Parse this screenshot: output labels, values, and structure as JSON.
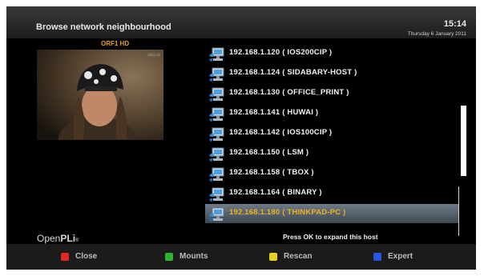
{
  "header": {
    "title": "Browse network neighbourhood",
    "time": "15:14",
    "date": "Thursday 6 January 2011"
  },
  "preview": {
    "channel": "ORF1 HD"
  },
  "hosts": [
    {
      "label": "192.168.1.120 ( IOS200CIP )",
      "selected": false
    },
    {
      "label": "192.168.1.124 ( SIDABARY-HOST )",
      "selected": false
    },
    {
      "label": "192.168.1.130 ( OFFICE_PRINT )",
      "selected": false
    },
    {
      "label": "192.168.1.141 ( HUWAI )",
      "selected": false
    },
    {
      "label": "192.168.1.142 ( IOS100CIP )",
      "selected": false
    },
    {
      "label": "192.168.1.150 ( LSM )",
      "selected": false
    },
    {
      "label": "192.168.1.158 ( TBOX )",
      "selected": false
    },
    {
      "label": "192.168.1.164 ( BINARY )",
      "selected": false
    },
    {
      "label": "192.168.1.180 ( THINKPAD-PC )",
      "selected": true
    }
  ],
  "logo": {
    "part1": "Open",
    "part2": "PLi",
    "suffix": "®"
  },
  "hint": "Press OK to expand this host",
  "footer": [
    {
      "label": "Close",
      "color": "#e02828"
    },
    {
      "label": "Mounts",
      "color": "#30b030"
    },
    {
      "label": "Rescan",
      "color": "#e8d020"
    },
    {
      "label": "Expert",
      "color": "#2858e0"
    }
  ]
}
